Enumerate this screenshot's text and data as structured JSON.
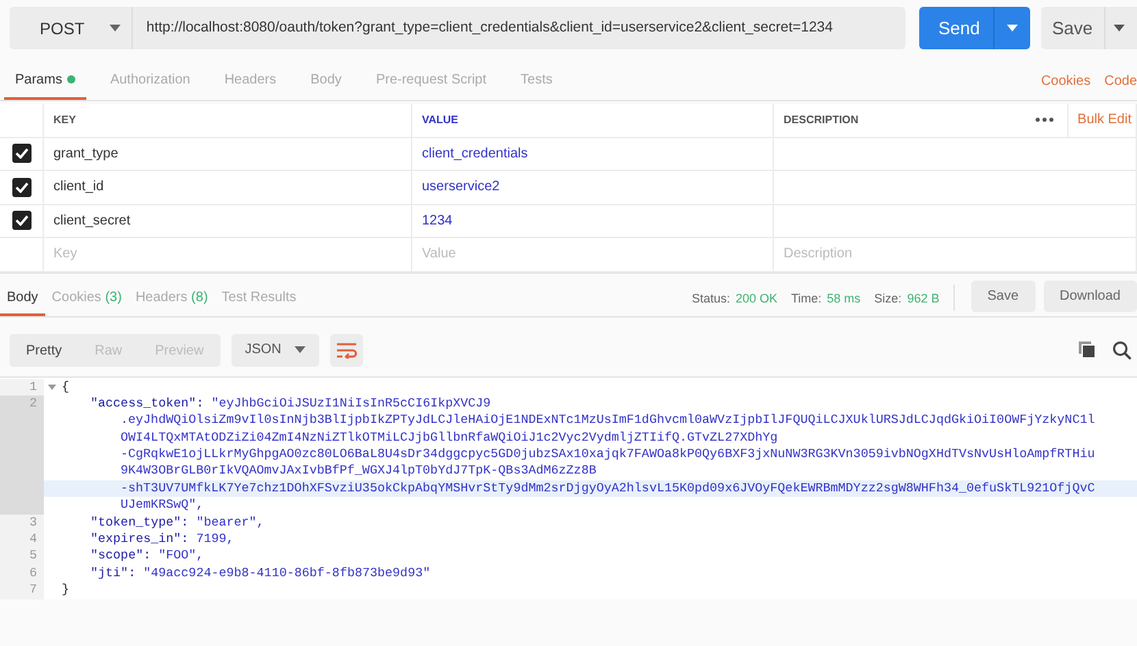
{
  "request": {
    "method": "POST",
    "url": "http://localhost:8080/oauth/token?grant_type=client_credentials&client_id=userservice2&client_secret=1234",
    "send": "Send",
    "save": "Save"
  },
  "request_tabs": [
    {
      "label": "Params",
      "selected": true,
      "has_dot": true
    },
    {
      "label": "Authorization",
      "selected": false,
      "has_dot": false
    },
    {
      "label": "Headers",
      "selected": false,
      "has_dot": false
    },
    {
      "label": "Body",
      "selected": false,
      "has_dot": false
    },
    {
      "label": "Pre-request Script",
      "selected": false,
      "has_dot": false
    },
    {
      "label": "Tests",
      "selected": false,
      "has_dot": false
    }
  ],
  "request_links": [
    "Cookies",
    "Code"
  ],
  "params": {
    "columns": [
      "KEY",
      "VALUE",
      "DESCRIPTION"
    ],
    "bulk_edit": "Bulk Edit",
    "rows": [
      {
        "key": "grant_type",
        "value": "client_credentials",
        "checked": true
      },
      {
        "key": "client_id",
        "value": "userservice2",
        "checked": true
      },
      {
        "key": "client_secret",
        "value": "1234",
        "checked": true
      }
    ],
    "new_row": {
      "key_placeholder": "Key",
      "value_placeholder": "Value",
      "description_placeholder": "Description"
    }
  },
  "response_tabs": [
    {
      "label": "Body",
      "selected": true
    },
    {
      "label": "Cookies",
      "count": "(3)",
      "selected": false
    },
    {
      "label": "Headers",
      "count": "(8)",
      "selected": false
    },
    {
      "label": "Test Results",
      "selected": false
    }
  ],
  "status": [
    {
      "label": "Status:",
      "value": "200 OK"
    },
    {
      "label": "Time:",
      "value": "58 ms"
    },
    {
      "label": "Size:",
      "value": "962 B"
    }
  ],
  "response_buttons": [
    "Save",
    "Download"
  ],
  "view_modes": [
    {
      "label": "Pretty",
      "selected": true
    },
    {
      "label": "Raw",
      "selected": false
    },
    {
      "label": "Preview",
      "selected": false
    }
  ],
  "format": "JSON",
  "code_lines": [
    {
      "number": "1",
      "kind": "open",
      "text": "{",
      "active": false
    },
    {
      "number": "2",
      "kind": "pair",
      "key": "\"access_token\":",
      "active": true,
      "value_rows": [
        {
          "text": "\"eyJhbGciOiJSUzI1NiIsInR5cCI6IkpXVCJ9",
          "highlighted": false
        },
        {
          "text": ".eyJhdWQiOlsiZm9vIl0sInNjb3BlIjpbIkZPTyJdLCJleHAiOjE1NDExNTc1MzUsImF1dGhvcml0aWVzIjpbIlJFQUQiLCJXUklURSJdLCJqdGkiOiI0OWFjYzkyNC1l",
          "highlighted": false
        },
        {
          "text": "OWI4LTQxMTAtODZiZi04ZmI4NzNiZTlkOTMiLCJjbGllbnRfaWQiOiJ1c2Vyc2VydmljZTIifQ.GTvZL27XDhYg",
          "highlighted": false
        },
        {
          "text": "-CgRqkwE1ojLLkrMyGhpgAO0zc80LO6BaL8U4sDr34dggcpyc5GD0jubzSAx10xajqk7FAWOa8kP0Qy6BXF3jxNuNW3RG3KVn3059ivbNOgXHdTVsNvUsHloAmpfRTHiu",
          "highlighted": false
        },
        {
          "text": "9K4W3OBrGLB0rIkVQAOmvJAxIvbBfPf_WGXJ4lpT0bYdJ7TpK-QBs3AdM6zZz8B",
          "highlighted": false
        },
        {
          "text": "-shT3UV7UMfkLK7Ye7chz1DOhXFSvziU35okCkpAbqYMSHvrStTy9dMm2srDjgyOyA2hlsvL15K0pd09x6JVOyFQekEWRBmMDYzz2sgW8WHFh34_0efuSkTL921OfjQvC",
          "highlighted": true
        },
        {
          "text": "UJemKRSwQ\",",
          "highlighted": false
        }
      ]
    },
    {
      "number": "3",
      "kind": "pair",
      "key": "\"token_type\":",
      "active": false,
      "value_rows": [
        {
          "text": "\"bearer\",",
          "highlighted": false
        }
      ]
    },
    {
      "number": "4",
      "kind": "pair",
      "key": "\"expires_in\":",
      "active": false,
      "value_rows": [
        {
          "text": "7199,",
          "highlighted": false
        }
      ]
    },
    {
      "number": "5",
      "kind": "pair",
      "key": "\"scope\":",
      "active": false,
      "value_rows": [
        {
          "text": "\"FOO\",",
          "highlighted": false
        }
      ]
    },
    {
      "number": "6",
      "kind": "pair",
      "key": "\"jti\":",
      "active": false,
      "value_rows": [
        {
          "text": "\"49acc924-e9b8-4110-86bf-8fb873be9d93\"",
          "highlighted": false
        }
      ]
    },
    {
      "number": "7",
      "kind": "close",
      "text": "}",
      "active": false
    }
  ]
}
